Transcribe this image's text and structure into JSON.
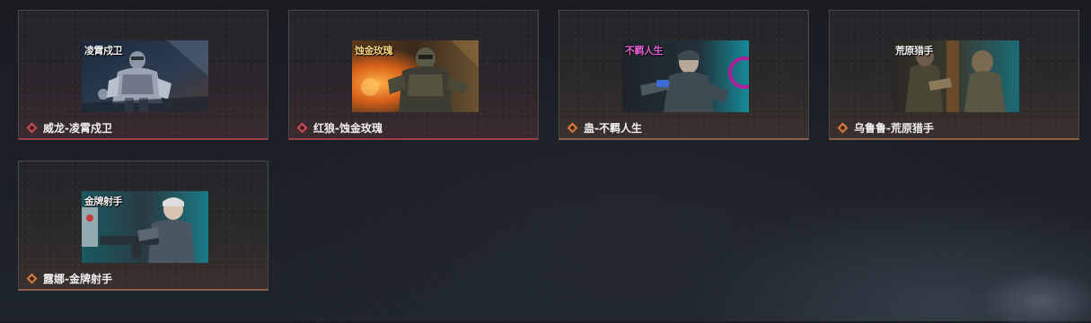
{
  "skins": [
    {
      "label": "威龙-凌霄戍卫",
      "thumb_title": "凌霄戍卫",
      "rarity": "red",
      "rarity_color": "#c94a52",
      "icon": "rarity-diamond-icon"
    },
    {
      "label": "红狼-蚀金玫瑰",
      "thumb_title": "蚀金玫瑰",
      "rarity": "red",
      "rarity_color": "#c94a52",
      "icon": "rarity-diamond-icon"
    },
    {
      "label": "蛊-不羁人生",
      "thumb_title": "不羁人生",
      "rarity": "orange",
      "rarity_color": "#d9773c",
      "icon": "rarity-diamond-icon"
    },
    {
      "label": "乌鲁鲁-荒原猎手",
      "thumb_title": "荒原猎手",
      "rarity": "orange",
      "rarity_color": "#d9773c",
      "icon": "rarity-diamond-icon"
    },
    {
      "label": "露娜-金牌射手",
      "thumb_title": "金牌射手",
      "rarity": "orange",
      "rarity_color": "#d9773c",
      "icon": "rarity-diamond-icon"
    }
  ]
}
